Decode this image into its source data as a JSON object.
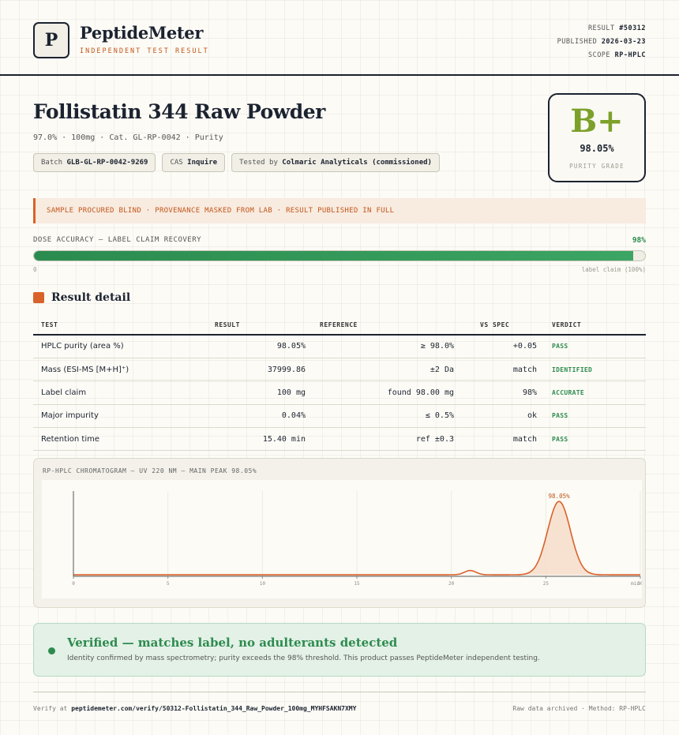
{
  "header": {
    "logo_letter": "P",
    "brand": "PeptideMeter",
    "brand_sub": "INDEPENDENT TEST RESULT",
    "result_label": "RESULT",
    "result_value": "#50312",
    "published_label": "PUBLISHED",
    "published_value": "2026-03-23",
    "scope_label": "SCOPE",
    "scope_value": "RP-HPLC"
  },
  "product": {
    "title": "Follistatin 344 Raw Powder",
    "subline": "97.0% · 100mg · Cat. GL-RP-0042 · Purity",
    "chips": [
      {
        "label": "Batch",
        "value": "GLB-GL-RP-0042-9269"
      },
      {
        "label": "CAS",
        "value": "Inquire"
      },
      {
        "label": "Tested by",
        "value": "Colmaric Analyticals (commissioned)"
      }
    ]
  },
  "grade": {
    "letter": "B+",
    "value": "98.05%",
    "label": "PURITY GRADE",
    "color": "#7ca02a"
  },
  "notice": "SAMPLE PROCURED BLIND · PROVENANCE MASKED FROM LAB · RESULT PUBLISHED IN FULL",
  "dose": {
    "label": "DOSE ACCURACY — LABEL CLAIM RECOVERY",
    "percent_text": "98%",
    "fraction": 0.98,
    "min_label": "0",
    "claim_label": "label claim (100%)"
  },
  "section_title": "Result detail",
  "table": {
    "headers": [
      "TEST",
      "RESULT",
      "REFERENCE",
      "VS SPEC",
      "VERDICT"
    ],
    "rows": [
      {
        "test": "HPLC purity (area %)",
        "result": "98.05%",
        "reference": "≥ 98.0%",
        "vs": "+0.05",
        "verdict": "PASS"
      },
      {
        "test": "Mass (ESI-MS [M+H]⁺)",
        "result": "37999.86",
        "reference": "±2 Da",
        "vs": "match",
        "verdict": "IDENTIFIED"
      },
      {
        "test": "Label claim",
        "result": "100 mg",
        "reference": "found 98.00 mg",
        "vs": "98%",
        "verdict": "ACCURATE"
      },
      {
        "test": "Major impurity",
        "result": "0.04%",
        "reference": "≤ 0.5%",
        "vs": "ok",
        "verdict": "PASS"
      },
      {
        "test": "Retention time",
        "result": "15.40 min",
        "reference": "ref ±0.3",
        "vs": "match",
        "verdict": "PASS"
      }
    ]
  },
  "chromatogram": {
    "label": "RP-HPLC CHROMATOGRAM — UV 220 NM — MAIN PEAK 98.05%",
    "peak_label": "98.05%"
  },
  "chart_data": {
    "type": "line",
    "title": "RP-HPLC CHROMATOGRAM — UV 220 NM — MAIN PEAK 98.05%",
    "xlabel": "min",
    "ylabel": "",
    "xlim": [
      0,
      30
    ],
    "ylim": [
      0,
      100
    ],
    "x_ticks": [
      0,
      5,
      10,
      15,
      20,
      25,
      30
    ],
    "x_tick_labels": [
      "0",
      "5",
      "10",
      "15",
      "20",
      "25",
      "30"
    ],
    "baseline": 1.8,
    "peaks": [
      {
        "center": 21.0,
        "height": 5,
        "width": 0.3
      },
      {
        "center": 25.7,
        "height": 86,
        "width": 0.6,
        "label": "98.05%"
      }
    ],
    "line_color": "#d9622a"
  },
  "verified": {
    "title": "Verified — matches label, no adulterants detected",
    "subtitle": "Identity confirmed by mass spectrometry; purity exceeds the 98% threshold. This product passes PeptideMeter independent testing."
  },
  "footer": {
    "verify_prefix": "Verify at",
    "verify_url": "peptidemeter.com/verify/50312-Follistatin_344_Raw_Powder_100mg_MYHFSAKN7XMY",
    "right": "Raw data archived · Method: RP-HPLC"
  }
}
